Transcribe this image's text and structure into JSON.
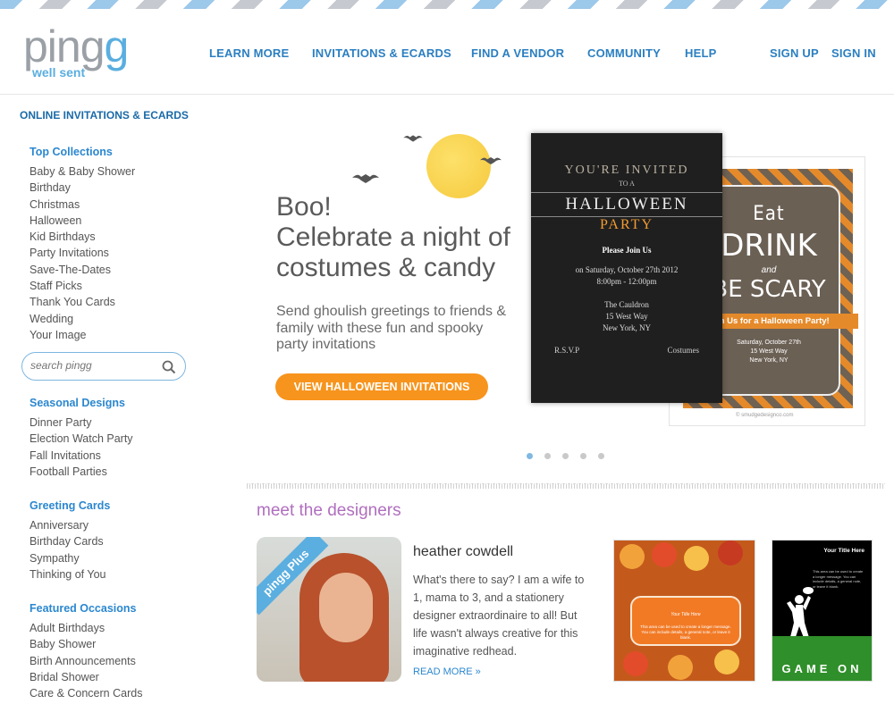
{
  "header": {
    "logo_text_1": "ping",
    "logo_text_2": "g",
    "logo_tagline": "well sent",
    "nav": [
      "LEARN MORE",
      "INVITATIONS & ECARDS",
      "FIND A VENDOR",
      "COMMUNITY",
      "HELP"
    ],
    "sign_up": "SIGN UP",
    "sign_in": "SIGN IN"
  },
  "sidebar": {
    "title": "ONLINE INVITATIONS & ECARDS",
    "top_collections": {
      "heading": "Top Collections",
      "items": [
        "Baby & Baby Shower",
        "Birthday",
        "Christmas",
        "Halloween",
        "Kid Birthdays",
        "Party Invitations",
        "Save-The-Dates",
        "Staff Picks",
        "Thank You Cards",
        "Wedding",
        "Your Image"
      ]
    },
    "search_placeholder": "search pingg",
    "seasonal": {
      "heading": "Seasonal Designs",
      "items": [
        "Dinner Party",
        "Election Watch Party",
        "Fall Invitations",
        "Football Parties"
      ]
    },
    "greeting": {
      "heading": "Greeting Cards",
      "items": [
        "Anniversary",
        "Birthday Cards",
        "Sympathy",
        "Thinking of You"
      ]
    },
    "featured": {
      "heading": "Featured Occasions",
      "items": [
        "Adult Birthdays",
        "Baby Shower",
        "Birth Announcements",
        "Bridal Shower",
        "Care & Concern Cards"
      ]
    }
  },
  "hero": {
    "title_line1": "Boo!",
    "title_line2": "Celebrate a night of",
    "title_line3": "costumes & candy",
    "subtitle": "Send ghoulish greetings to friends & family with these fun and spooky party invitations",
    "button": "VIEW HALLOWEEN INVITATIONS",
    "slide_count": 5,
    "active_slide": 1
  },
  "card_dark": {
    "invited": "YOU'RE INVITED",
    "to_a": "TO A",
    "halloween": "HALLOWEEN",
    "party": "PARTY",
    "join": "Please Join Us",
    "date": "on Saturday, October 27th 2012",
    "time": "8:00pm - 12:00pm",
    "venue1": "The Cauldron",
    "venue2": "15 West Way",
    "venue3": "New York, NY",
    "rsvp": "R.S.V.P",
    "costumes": "Costumes"
  },
  "card_orange": {
    "eat": "Eat",
    "drink": "DRINK",
    "and": "and",
    "scary": "BE SCARY",
    "join": "oin Us for a Halloween Party!",
    "date": "Saturday, October 27th",
    "addr1": "15 West Way",
    "addr2": "New York, NY",
    "credit": "© smudgedesignco.com"
  },
  "designers": {
    "section_title": "meet the designers",
    "badge": "pingg Plus",
    "name": "heather cowdell",
    "bio": "What's there to say? I am a wife to 1, mama to 3, and a stationery designer extraordinaire to all! But life wasn't always creative for this imaginative redhead.",
    "read_more": "READ MORE »"
  },
  "card_fall": {
    "script": "Your Title Here",
    "text": "This area can be used to create a longer message. You can include details, a general note, or leave it blank."
  },
  "card_football": {
    "title": "Your Title Here",
    "text": "This area can be used to create a longer message. You can include details, a general note, or leave it blank.",
    "game_on": "GAME ON"
  },
  "colors": {
    "brand_blue": "#2b87cf",
    "accent_orange": "#f7941d",
    "designer_purple": "#b06fbf"
  }
}
